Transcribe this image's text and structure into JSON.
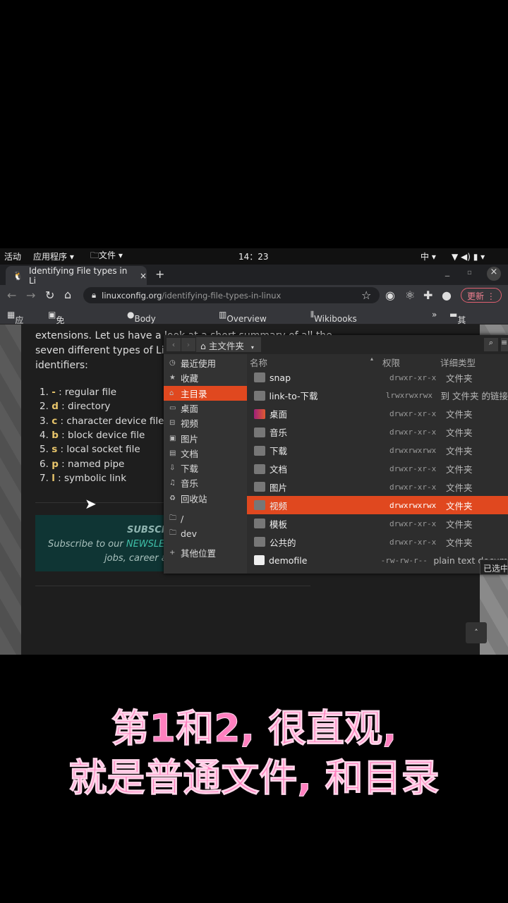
{
  "topbar": {
    "activities": "活动",
    "apps": "应用程序 ▾",
    "files": "🗀文件 ▾",
    "clock": "14：23",
    "ime": "中 ▾"
  },
  "browser": {
    "tab_title": "Identifying File types in Li",
    "tab_close": "×",
    "new_tab": "+",
    "url_host": "linuxconfig.org",
    "url_path": "/identifying-file-types-in-linux",
    "update_label": "更新",
    "bookmarks": [
      "应用",
      "免费在线录屏",
      "Body - Fields -...",
      "Overview —...",
      "Wikibooks"
    ],
    "more": "»",
    "other_bookmarks": "其他书签"
  },
  "article": {
    "line1": "extensions. Let us have a look at a short summary of all the",
    "line2": "seven different types of Linux",
    "line3": "identifiers:",
    "list": [
      {
        "n": "1.",
        "k": "-",
        "t": ": regular file"
      },
      {
        "n": "2.",
        "k": "d",
        "t": ": directory"
      },
      {
        "n": "3.",
        "k": "c",
        "t": ": character device file"
      },
      {
        "n": "4.",
        "k": "b",
        "t": ": block device file"
      },
      {
        "n": "5.",
        "k": "s",
        "t": ": local socket file"
      },
      {
        "n": "6.",
        "k": "p",
        "t": ": named pipe"
      },
      {
        "n": "7.",
        "k": "l",
        "t": ": symbolic link"
      }
    ],
    "subscribe_title": "SUBSCRIBE",
    "subscribe_pre": "Subscribe to our ",
    "subscribe_link": "NEWSLETT",
    "subscribe_line2": "jobs, career ad"
  },
  "filemanager": {
    "location": "主文件夹",
    "sidebar": [
      "最近使用",
      "收藏",
      "主目录",
      "桌面",
      "视频",
      "图片",
      "文档",
      "下载",
      "音乐",
      "回收站",
      "/",
      "dev",
      "其他位置"
    ],
    "columns": {
      "name": "名称",
      "perm": "权限",
      "type": "详细类型"
    },
    "rows": [
      {
        "name": "snap",
        "perm": "drwxr-xr-x",
        "type": "文件夹"
      },
      {
        "name": "link-to-下载",
        "perm": "lrwxrwxrwx",
        "type": "到 文件夹 的链接"
      },
      {
        "name": "桌面",
        "perm": "drwxr-xr-x",
        "type": "文件夹"
      },
      {
        "name": "音乐",
        "perm": "drwxr-xr-x",
        "type": "文件夹"
      },
      {
        "name": "下载",
        "perm": "drwxrwxrwx",
        "type": "文件夹"
      },
      {
        "name": "文档",
        "perm": "drwxr-xr-x",
        "type": "文件夹"
      },
      {
        "name": "图片",
        "perm": "drwxr-xr-x",
        "type": "文件夹"
      },
      {
        "name": "视频",
        "perm": "drwxrwxrwx",
        "type": "文件夹"
      },
      {
        "name": "模板",
        "perm": "drwxr-xr-x",
        "type": "文件夹"
      },
      {
        "name": "公共的",
        "perm": "drwxr-xr-x",
        "type": "文件夹"
      },
      {
        "name": "demofile",
        "perm": "-rw-rw-r--",
        "type": "plain text docum"
      }
    ],
    "selected_tip": "已选中"
  },
  "caption": {
    "line1": "第1和2, 很直观,",
    "line2": "就是普通文件, 和目录"
  },
  "colors": {
    "accent": "#e0481f",
    "caption": "#ff7fbf"
  }
}
